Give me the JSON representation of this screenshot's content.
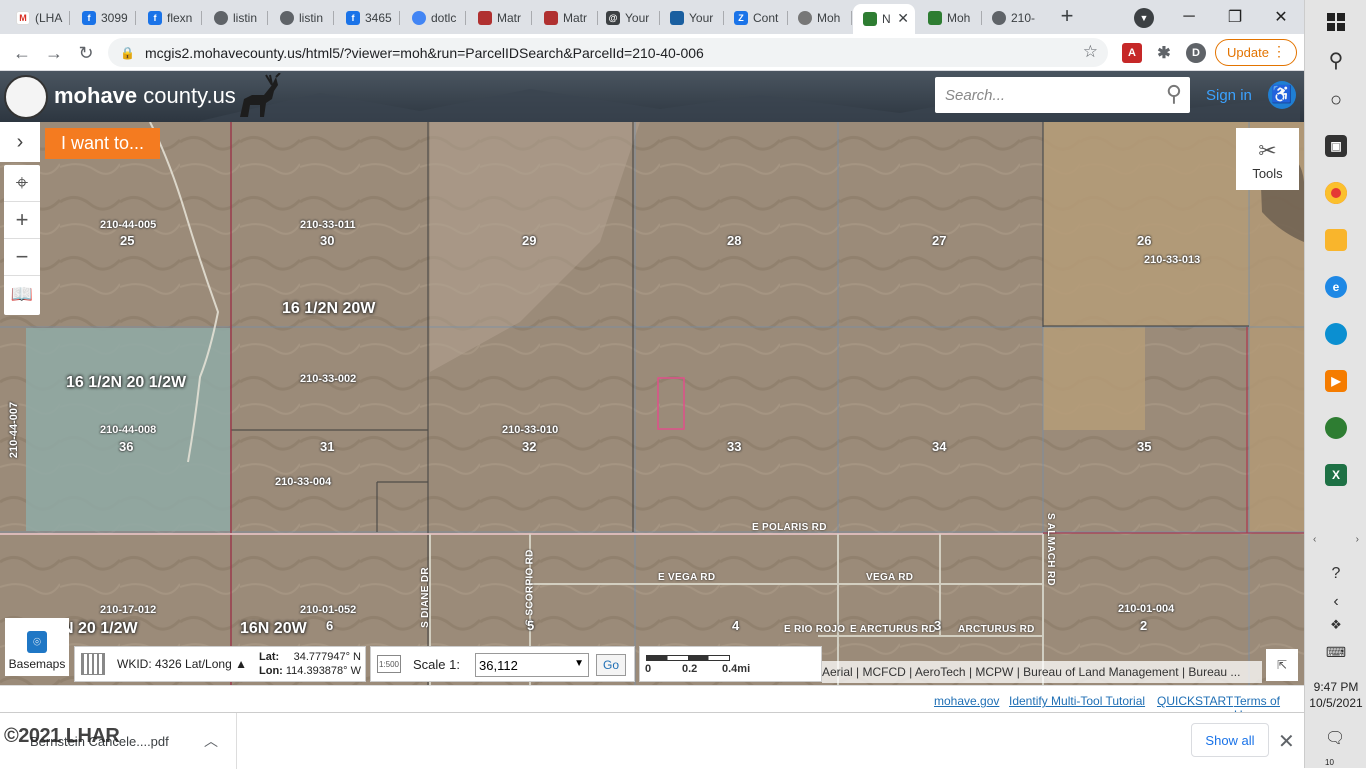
{
  "browser": {
    "tabs": [
      {
        "label": "(LHA",
        "icon": "gmail-icon",
        "color": "#d93025"
      },
      {
        "label": "3099",
        "icon": "flexmls-icon",
        "color": "#1a73e8"
      },
      {
        "label": "flexn",
        "icon": "flexmls-icon",
        "color": "#1a73e8"
      },
      {
        "label": "listin",
        "icon": "globe-icon",
        "color": "#5f6368"
      },
      {
        "label": "listin",
        "icon": "globe-icon",
        "color": "#5f6368"
      },
      {
        "label": "3465",
        "icon": "flexmls-icon",
        "color": "#1a73e8"
      },
      {
        "label": "dotlc",
        "icon": "dotloop-icon",
        "color": "#4285f4"
      },
      {
        "label": "Matr",
        "icon": "matrix-icon",
        "color": "#b03030"
      },
      {
        "label": "Matr",
        "icon": "matrix-icon",
        "color": "#b03030"
      },
      {
        "label": "Your",
        "icon": "doc-icon",
        "color": "#3c4043"
      },
      {
        "label": "Your",
        "icon": "map-icon",
        "color": "#1a5fa0"
      },
      {
        "label": "Cont",
        "icon": "zillow-icon",
        "color": "#1a73e8"
      },
      {
        "label": "Moh",
        "icon": "county-icon",
        "color": "#555555"
      },
      {
        "label": "N",
        "icon": "map-icon",
        "color": "#2e7d32",
        "active": true
      },
      {
        "label": "Moh",
        "icon": "map-icon",
        "color": "#2e7d32"
      },
      {
        "label": "210-",
        "icon": "globe-icon",
        "color": "#5f6368"
      }
    ],
    "new_tab": "+",
    "url": "mcgis2.mohavecounty.us/html5/?viewer=moh&run=ParcelIDSearch&ParcelId=210-40-006",
    "update_label": "Update",
    "profile_initial": "D"
  },
  "site": {
    "logo_brand": "mohave",
    "logo_suffix": " county.us",
    "search_placeholder": "Search...",
    "signin": "Sign in"
  },
  "map": {
    "i_want_to": "I want to...",
    "tools_label": "Tools",
    "basemaps_label": "Basemaps",
    "wkid": "WKID: 4326 Lat/Long",
    "lat_label": "Lat:",
    "lat_value": "34.777947° N",
    "lon_label": "Lon:",
    "lon_value": "114.393878° W",
    "scale_label": "Scale 1:",
    "scale_value": "36,112",
    "go_label": "Go",
    "scalebar": [
      "0",
      "0.2",
      "0.4mi"
    ],
    "attribution": "Aerial | MCFCD | AeroTech | MCPW | Bureau of Land Management | Bureau ...",
    "labels": {
      "p1": "210-44-005",
      "s1": "25",
      "p2": "210-33-011",
      "s2": "30",
      "s3": "29",
      "s4": "28",
      "s5": "27",
      "s6": "26",
      "p6": "210-33-013",
      "twp1": "16 1/2N 20W",
      "twp2": "16 1/2N 20 1/2W",
      "p7": "210-33-002",
      "p8": "210-44-008",
      "s8": "36",
      "p9": "210-44-007",
      "s10": "31",
      "p11": "210-33-004",
      "p12": "210-33-010",
      "s12": "32",
      "s13": "33",
      "s14": "34",
      "s15": "35",
      "r1": "E POLARIS RD",
      "r2": "E VEGA RD",
      "r3": "VEGA RD",
      "r4": "S DIANE DR",
      "r5": "S SCORPIO RD",
      "r6": "S ALMACH RD",
      "r7": "E RIO ROJO",
      "r8": "E ARCTURUS RD",
      "r9": "ARCTURUS RD",
      "p16": "210-17-012",
      "twp3": "N 20 1/2W",
      "p17": "210-01-052",
      "twp4": "16N 20W",
      "s17": "6",
      "s18": "5",
      "s19": "4",
      "s20": "3",
      "p21": "210-01-004",
      "s21": "2"
    }
  },
  "footer": {
    "links": [
      "mohave.gov",
      "Identify Multi-Tool Tutorial",
      "QUICKSTART",
      "Terms of Use"
    ]
  },
  "downloads": {
    "file": "Bernstein Cancele....pdf",
    "watermark": "©2021 LHAR",
    "show_all": "Show all"
  },
  "taskbar": {
    "time": "9:47 PM",
    "date": "10/5/2021",
    "notifications": "10"
  },
  "colors": {
    "accent_orange": "#f47b20",
    "link_blue": "#1f6fb5",
    "parcel_highlight": "#e0508a"
  }
}
